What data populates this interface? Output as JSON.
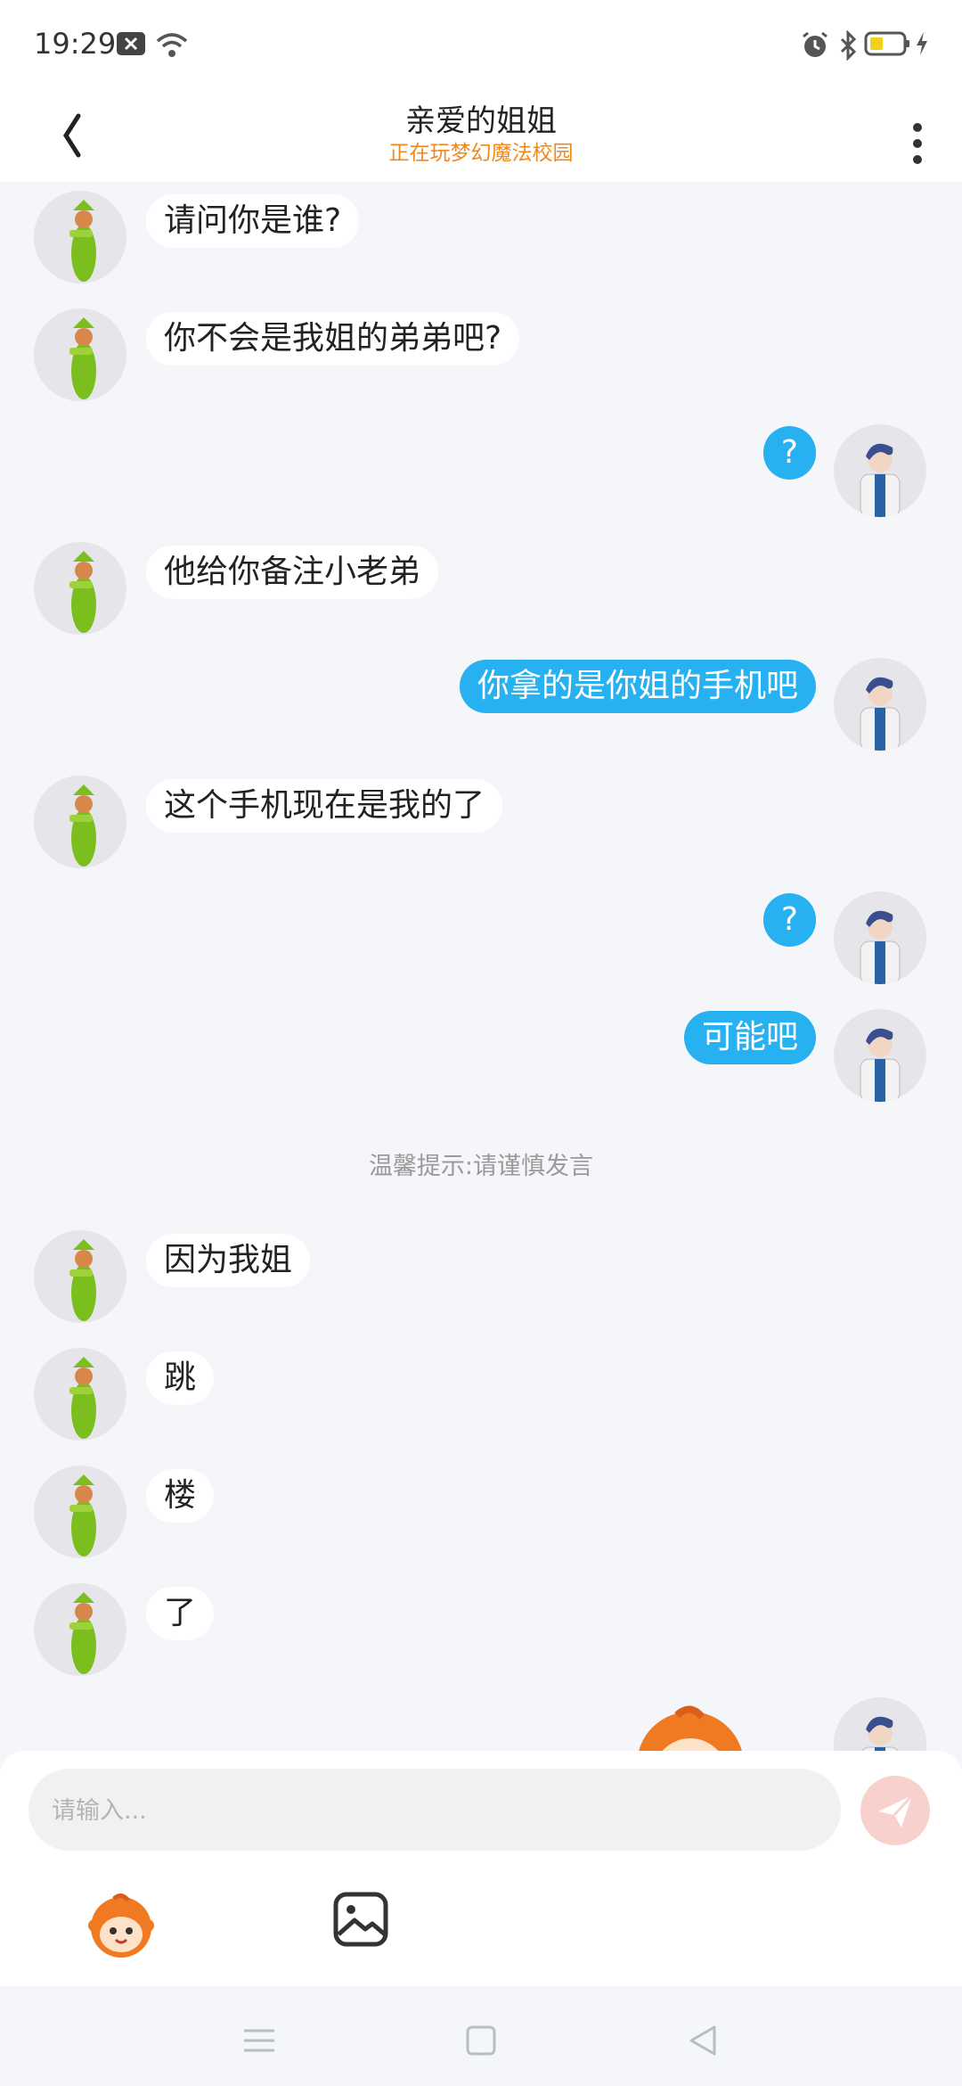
{
  "status_bar": {
    "time": "19:29",
    "icons": [
      "notification-x-icon",
      "wifi-icon",
      "alarm-icon",
      "bluetooth-icon",
      "battery-icon",
      "charging-icon"
    ],
    "battery_color": "#f2d21a"
  },
  "header": {
    "title": "亲爱的姐姐",
    "subtitle": "正在玩梦幻魔法校园",
    "back_icon": "chevron-left-icon",
    "more_icon": "more-vertical-icon",
    "subtitle_color": "#ee8a1c"
  },
  "messages": [
    {
      "side": "left",
      "text": "请问你是谁?"
    },
    {
      "side": "left",
      "text": "你不会是我姐的弟弟吧?"
    },
    {
      "side": "right",
      "text": "?"
    },
    {
      "side": "left",
      "text": "他给你备注小老弟"
    },
    {
      "side": "right",
      "text": "你拿的是你姐的手机吧"
    },
    {
      "side": "left",
      "text": "这个手机现在是我的了"
    },
    {
      "side": "right",
      "text": "?"
    },
    {
      "side": "right",
      "text": "可能吧"
    },
    {
      "side": "left",
      "text": "因为我姐"
    },
    {
      "side": "left",
      "text": "跳"
    },
    {
      "side": "left",
      "text": "楼"
    },
    {
      "side": "left",
      "text": "了"
    }
  ],
  "notice": "温馨提示:请谨慎发言",
  "composer": {
    "placeholder": "请输入...",
    "send_icon": "paper-plane-icon",
    "emoji_icon": "emoji-mascot-icon",
    "image_icon": "image-icon"
  },
  "colors": {
    "bubble_right": "#28b1f0",
    "bubble_left": "#ffffff",
    "background": "#f4f6f9"
  },
  "nav": [
    "menu-icon",
    "home-icon",
    "back-triangle-icon"
  ]
}
